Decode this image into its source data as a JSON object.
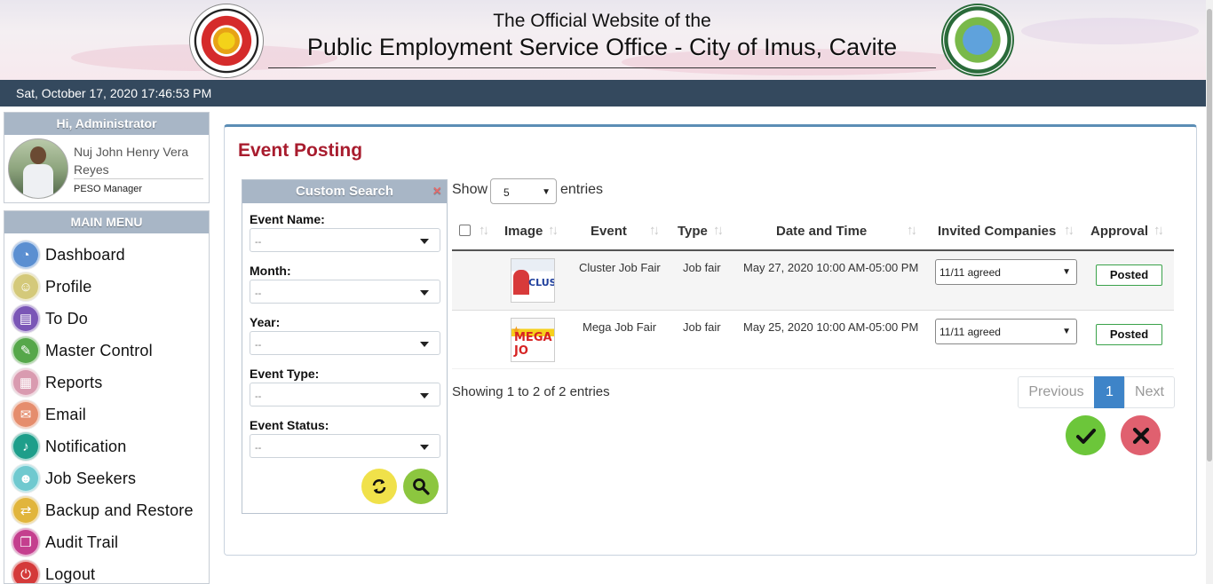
{
  "header": {
    "subtitle": "The Official Website of the",
    "title": "Public Employment Service Office - City of Imus, Cavite",
    "peso_logo_text": "PUBLIC EMPLOYMENT SERVICE OFFICE · P.E.S.O.",
    "imus_logo_text": "LUNGSOD NG IMUS · LALAWIGAN NG CAVITE"
  },
  "datetime": "Sat, October 17, 2020 17:46:53 PM",
  "user": {
    "greeting": "Hi, Administrator",
    "name": "Nuj John Henry Vera Reyes",
    "role": "PESO Manager"
  },
  "menu": {
    "title": "MAIN MENU",
    "items": [
      {
        "label": "Dashboard",
        "icon": "dashboard-icon",
        "color": "#5b8fd1"
      },
      {
        "label": "Profile",
        "icon": "profile-icon",
        "color": "#d4c97a"
      },
      {
        "label": "To Do",
        "icon": "todo-icon",
        "color": "#7a56b6"
      },
      {
        "label": "Master Control",
        "icon": "wrench-icon",
        "color": "#56a74a"
      },
      {
        "label": "Reports",
        "icon": "reports-icon",
        "color": "#d99bb0"
      },
      {
        "label": "Email",
        "icon": "email-icon",
        "color": "#e58d6d"
      },
      {
        "label": "Notification",
        "icon": "bell-icon",
        "color": "#1e9e8a"
      },
      {
        "label": "Job Seekers",
        "icon": "job-seekers-icon",
        "color": "#6fc9cf"
      },
      {
        "label": "Backup and Restore",
        "icon": "backup-icon",
        "color": "#e1b53c"
      },
      {
        "label": "Audit Trail",
        "icon": "audit-trail-icon",
        "color": "#c43f8e"
      },
      {
        "label": "Logout",
        "icon": "power-icon",
        "color": "#d43a3a"
      }
    ]
  },
  "page": {
    "title": "Event Posting"
  },
  "search": {
    "title": "Custom Search",
    "close": "×",
    "fields": [
      {
        "label": "Event Name:",
        "value": "--"
      },
      {
        "label": "Month:",
        "value": "--"
      },
      {
        "label": "Year:",
        "value": "--"
      },
      {
        "label": "Event Type:",
        "value": "--"
      },
      {
        "label": "Event Status:",
        "value": "--"
      }
    ],
    "refresh_color": "#f0e14a",
    "search_color": "#8cc63f"
  },
  "table": {
    "show_label": "Show",
    "entries_value": "5",
    "entries_label": "entries",
    "columns": [
      "Image",
      "Event",
      "Type",
      "Date and Time",
      "Invited Companies",
      "Approval"
    ],
    "rows": [
      {
        "image_text": "CLUSTER",
        "event": "Cluster Job Fair",
        "type": "Job fair",
        "datetime": "May 27, 2020 10:00 AM-05:00 PM",
        "invited": "11/11 agreed",
        "approval": "Posted"
      },
      {
        "image_text": "MEGA JO",
        "event": "Mega Job Fair",
        "type": "Job fair",
        "datetime": "May 25, 2020 10:00 AM-05:00 PM",
        "invited": "11/11 agreed",
        "approval": "Posted"
      }
    ],
    "info": "Showing 1 to 2 of 2 entries",
    "pager": {
      "previous": "Previous",
      "current": "1",
      "next": "Next"
    }
  },
  "actions": {
    "approve_color": "#6cc63a",
    "reject_color": "#e0606f"
  }
}
